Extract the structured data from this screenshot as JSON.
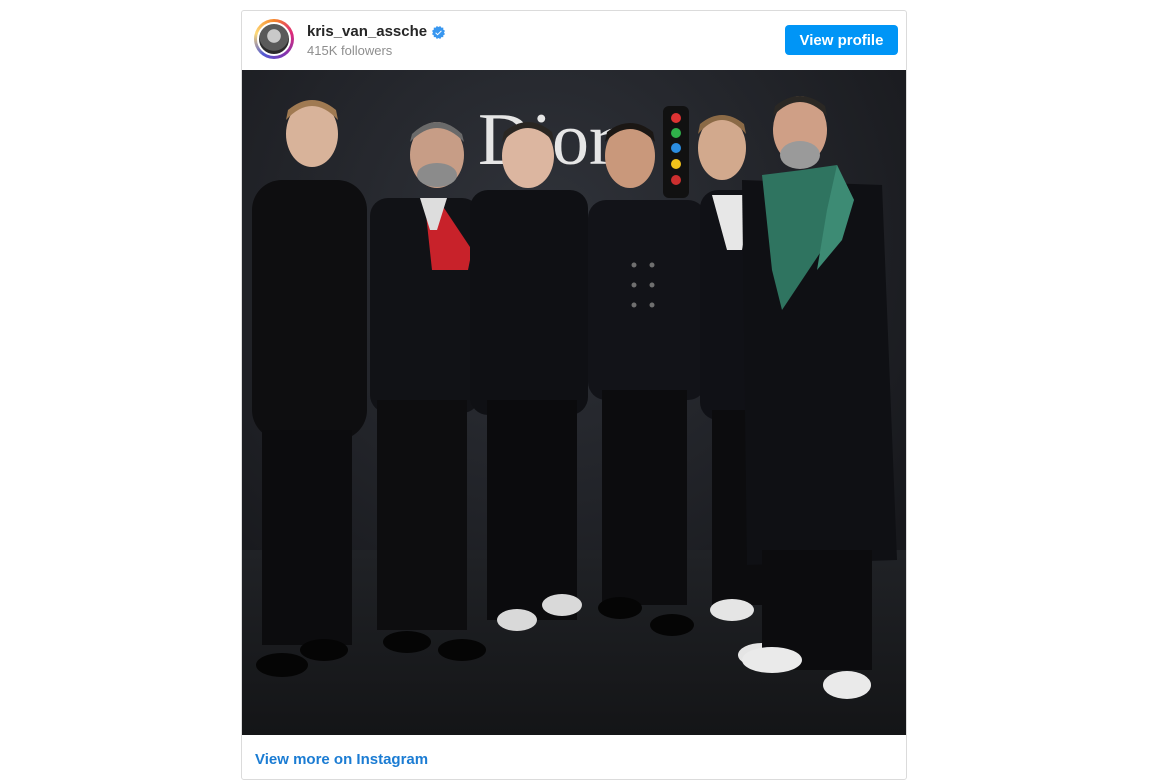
{
  "post": {
    "username": "kris_van_assche",
    "verified": true,
    "followers": "415K followers",
    "view_profile_label": "View profile",
    "photo_logo_text": "Dior",
    "photo_alt": "Six men in black suits posing in front of a Dior backdrop",
    "view_more_label": "View more on Instagram"
  },
  "colors": {
    "button_blue": "#0095f6",
    "link_blue": "#1b7cd3",
    "verified_blue": "#3897f0",
    "username_text": "#262626",
    "muted_text": "#8e8e8e"
  },
  "icons": {
    "verified": "verified-badge-icon",
    "avatar": "profile-avatar"
  }
}
